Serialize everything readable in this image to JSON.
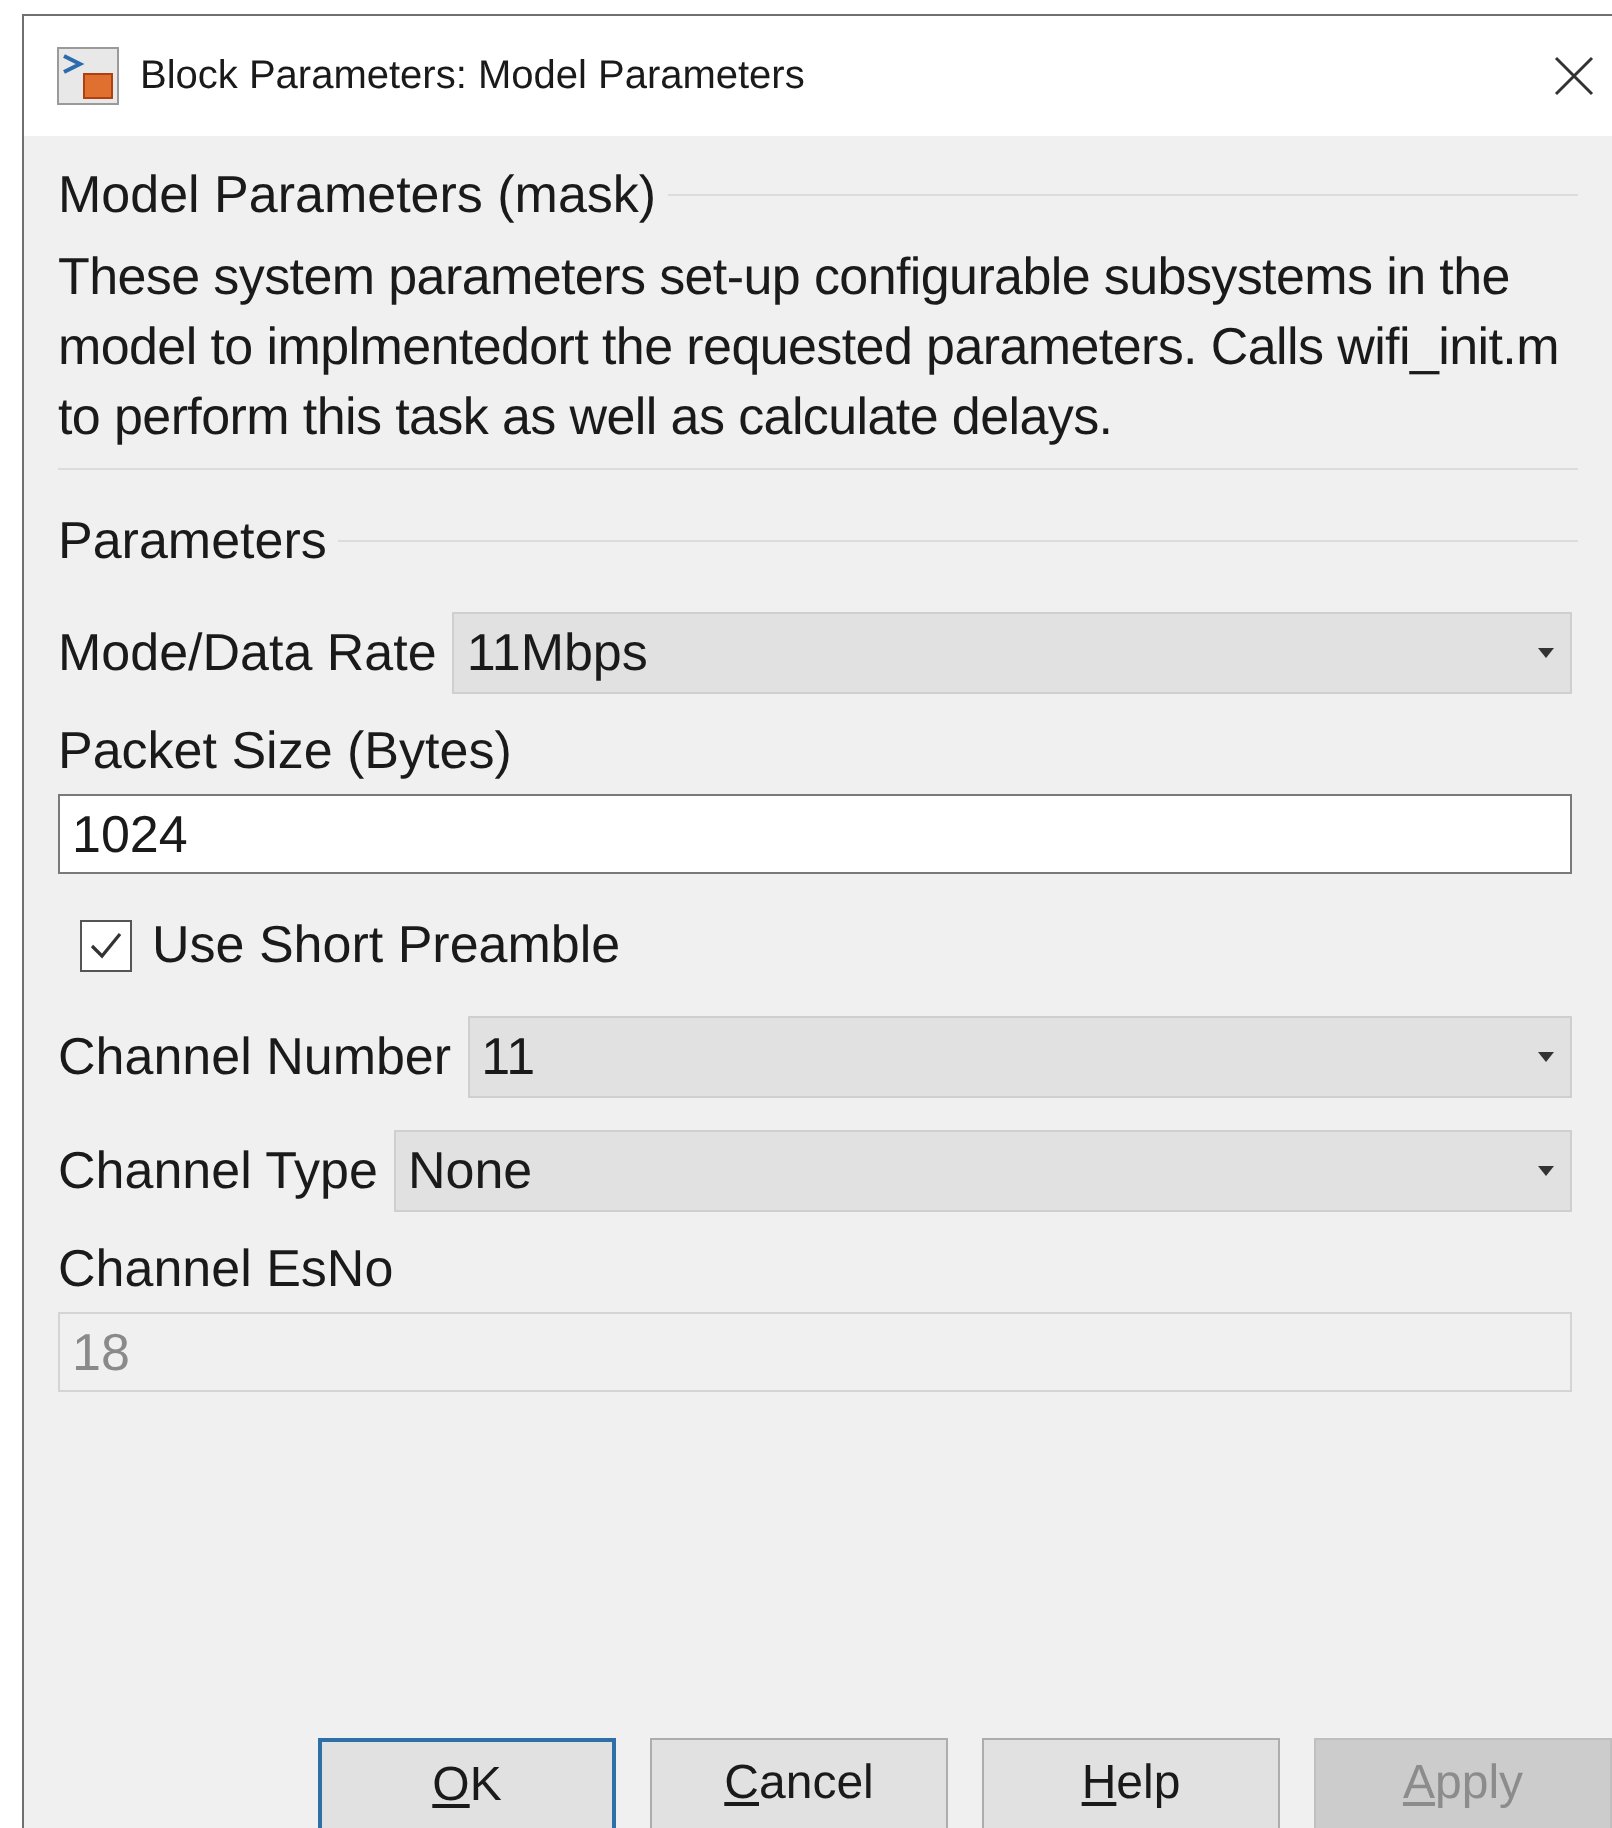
{
  "window": {
    "title": "Block Parameters: Model Parameters"
  },
  "mask_group": {
    "title": "Model Parameters (mask)",
    "description": "These system parameters set-up configurable subsystems in the model to implmentedort the requested parameters. Calls wifi_init.m to perform this task as well as calculate delays."
  },
  "parameters_group": {
    "title": "Parameters",
    "items": [
      {
        "kind": "popup",
        "label": "Mode/Data Rate",
        "value": "11Mbps"
      },
      {
        "kind": "edit",
        "label": "Packet Size (Bytes)",
        "value": "1024",
        "disabled": false
      },
      {
        "kind": "checkbox",
        "label": "Use Short Preamble",
        "checked": true
      },
      {
        "kind": "popup",
        "label": "Channel Number",
        "value": "11"
      },
      {
        "kind": "popup",
        "label": "Channel Type",
        "value": "None"
      },
      {
        "kind": "edit",
        "label": "Channel EsNo",
        "value": "18",
        "disabled": true
      }
    ]
  },
  "buttons": [
    {
      "label": "OK",
      "default": true,
      "disabled": false
    },
    {
      "label": "Cancel",
      "default": false,
      "disabled": false
    },
    {
      "label": "Help",
      "default": false,
      "disabled": false
    },
    {
      "label": "Apply",
      "default": false,
      "disabled": true
    }
  ]
}
